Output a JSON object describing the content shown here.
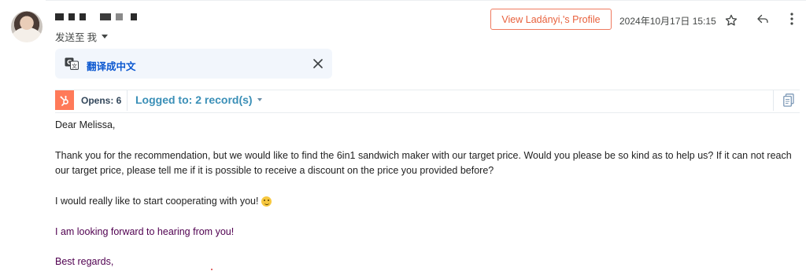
{
  "header": {
    "recipient_prefix": "发送至",
    "recipient": "我",
    "profile_button": "View Ladányi,'s Profile",
    "datetime": "2024年10月17日 15:15",
    "icons": {
      "star": "star-outline-icon",
      "reply": "reply-icon",
      "more": "more-vert-icon"
    }
  },
  "translate": {
    "label": "翻译成中文",
    "icon": "translate-icon",
    "close_icon": "close-icon"
  },
  "hubspot": {
    "opens_label": "Opens: 6",
    "logged_label": "Logged to: 2 record(s)",
    "brand_color": "#ff7a59",
    "icons": {
      "logo": "hubspot-sprocket-icon",
      "copy": "copy-document-icon"
    }
  },
  "email": {
    "greeting": "Dear Melissa,",
    "paragraph1": "Thank you for the recommendation, but we would like to find the 6in1 sandwich maker with our target price. Would you please be so kind as to help us? If it can not reach our target price, please tell me if it is possible to receive a discount on the price you provided before?",
    "paragraph2": "I would really like to start cooperating with you!",
    "paragraph2_emoji": "slightly-smiling-face-emoji",
    "paragraph3": "I am looking forward to hearing from you!",
    "signoff": "Best regards,",
    "quoted_text_color": "#500050"
  }
}
